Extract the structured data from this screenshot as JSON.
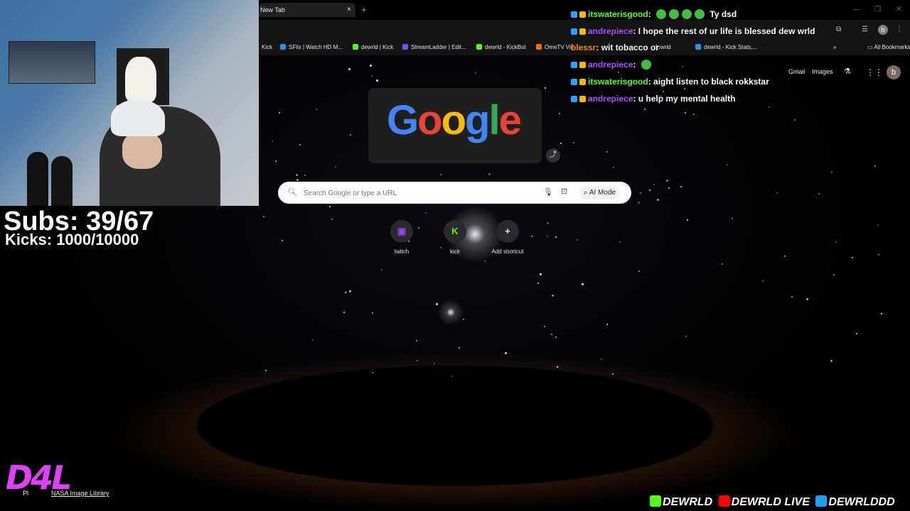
{
  "browser": {
    "tab_title": "New Tab",
    "tab_close": "×",
    "new_tab": "+",
    "window_controls": [
      "—",
      "❐",
      "✕"
    ],
    "profile_initial": "b",
    "bookmarks": [
      {
        "label": "Kick",
        "color": "#53fc18"
      },
      {
        "label": "SFlix | Watch HD M...",
        "color": "#2196f3"
      },
      {
        "label": "dewrld | Kick",
        "color": "#53fc18"
      },
      {
        "label": "StreamLadder | Edit...",
        "color": "#7c4dff"
      },
      {
        "label": "dewrld - KickBot",
        "color": "#53fc18"
      },
      {
        "label": "OmeTV Vid",
        "color": "#ff6d00"
      },
      {
        "label": "dewrld",
        "color": "#9e9e9e"
      },
      {
        "label": "dewrld - Kick Stats,...",
        "color": "#2196f3"
      }
    ],
    "more_bookmarks": "»",
    "all_bookmarks": "All Bookmarks"
  },
  "google": {
    "links": {
      "gmail": "Gmail",
      "images": "Images"
    },
    "account_initial": "b",
    "doodle_letters": [
      "G",
      "o",
      "o",
      "g",
      "l",
      "e"
    ],
    "doodle_colors": [
      "#4285f4",
      "#ea4335",
      "#fbbc05",
      "#4285f4",
      "#34a853",
      "#ea4335"
    ],
    "search_placeholder": "Search Google or type a URL",
    "ai_mode_label": "AI Mode",
    "shortcuts": [
      {
        "label": "twitch",
        "glyph": "▣",
        "color": "#9146ff"
      },
      {
        "label": "kick",
        "glyph": "K",
        "color": "#53fc18"
      },
      {
        "label": "Add shortcut",
        "glyph": "+",
        "color": "#e8eaed"
      }
    ],
    "credit": "NASA Image Library"
  },
  "overlay": {
    "subs": "Subs: 39/67",
    "kicks": "Kicks: 1000/10000",
    "logo_text": "D4L",
    "logo_sub": "Pl",
    "chat": [
      {
        "user": "itswaterisgood",
        "text": ": ",
        "extra": "Ty dsd",
        "user_color": "#53fc18",
        "emotes": 4
      },
      {
        "user": "andrepiece",
        "text": ": I hope the rest of ur life is blessed dew wrld",
        "extra": "",
        "user_color": "#b04cff",
        "emotes": 0
      },
      {
        "user": "blessr",
        "text": ": wit tobacco or",
        "extra": "",
        "user_color": "#ff8c00",
        "emotes": 0
      },
      {
        "user": "andrepiece",
        "text": ": ",
        "extra": "",
        "user_color": "#b04cff",
        "emotes": 1
      },
      {
        "user": "itswaterisgood",
        "text": ": aight listen to black rokkstar",
        "extra": "",
        "user_color": "#53fc18",
        "emotes": 0
      },
      {
        "user": "andrepiece",
        "text": ": u help my mental health",
        "extra": "",
        "user_color": "#b04cff",
        "emotes": 0
      }
    ],
    "socials": [
      {
        "label": "DEWRLD",
        "color": "#53fc18"
      },
      {
        "label": "DEWRLD LIVE",
        "color": "#ff0000"
      },
      {
        "label": "DEWRLDDD",
        "color": "#1da1f2"
      }
    ]
  }
}
